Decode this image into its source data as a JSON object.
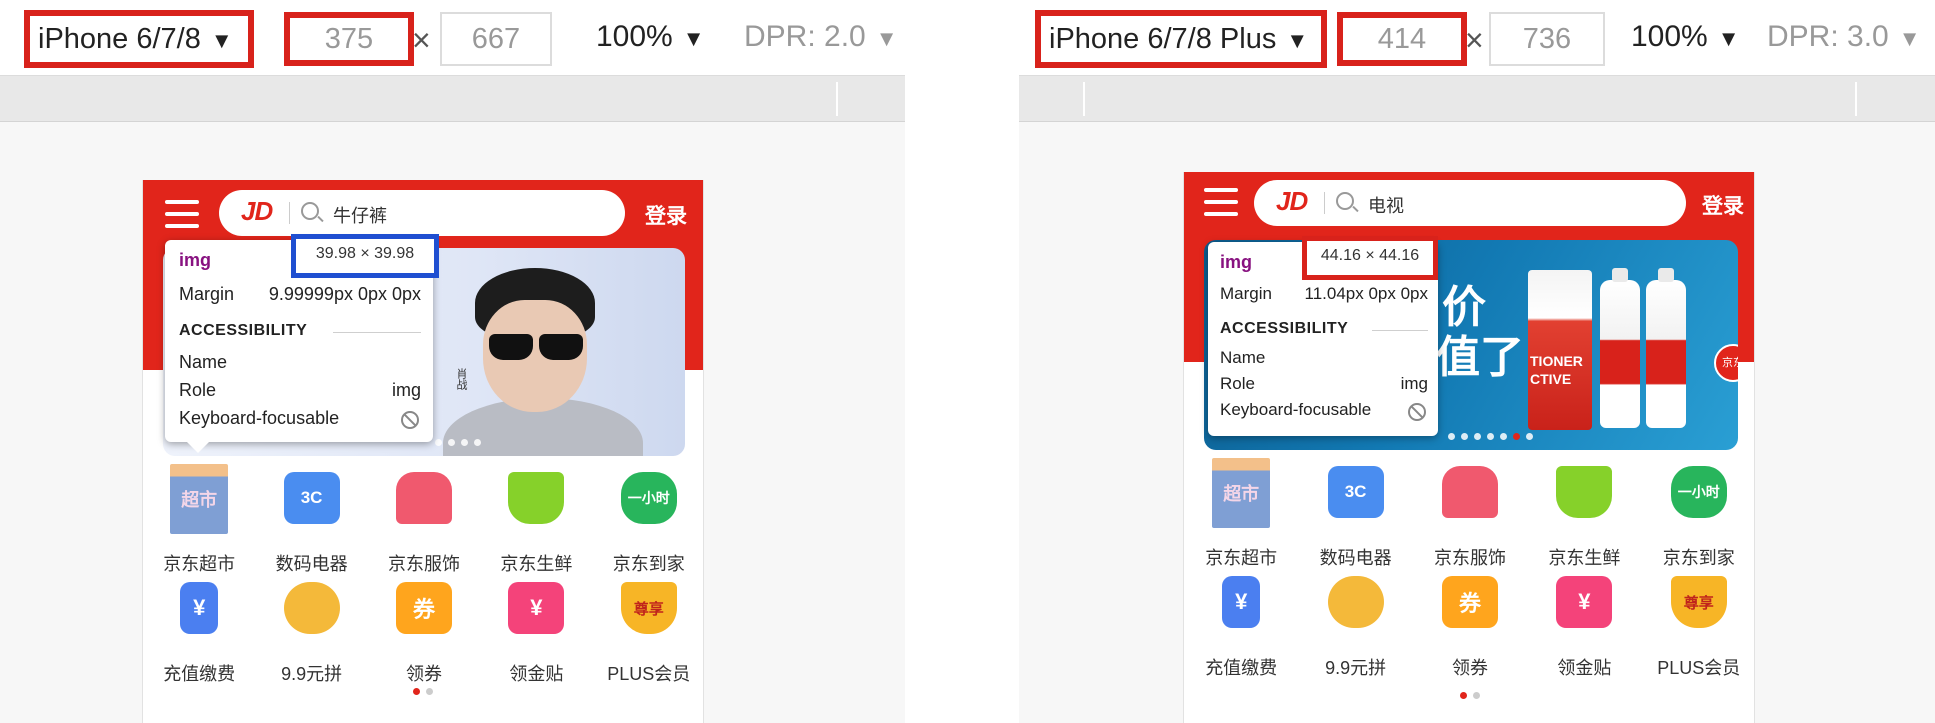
{
  "colors": {
    "highlight_red": "#d8221b",
    "highlight_blue": "#1f4fd1",
    "jd_red": "#e1251b",
    "tag_purple": "#881280"
  },
  "left": {
    "toolbar": {
      "device": "iPhone 6/7/8",
      "width": "375",
      "times": "×",
      "height": "667",
      "zoom": "100%",
      "dpr": "DPR: 2.0",
      "caret": "▼"
    },
    "phone": {
      "search_logo": "JD",
      "search_keyword": "牛仔裤",
      "login": "登录",
      "tooltip": {
        "tag": "img",
        "size": "39.98 × 39.98",
        "margin_label": "Margin",
        "margin_value": "9.99999px 0px 0px",
        "section": "ACCESSIBILITY",
        "name_label": "Name",
        "role_label": "Role",
        "role_value": "img",
        "focus_label": "Keyboard-focusable"
      },
      "banner_vertical_text": "肖战",
      "grid": [
        {
          "label": "京东超市",
          "icon": "supermarket-icon",
          "glyph": "超市"
        },
        {
          "label": "数码电器",
          "icon": "electronics-icon",
          "glyph": "3C"
        },
        {
          "label": "京东服饰",
          "icon": "clothing-icon",
          "glyph": ""
        },
        {
          "label": "京东生鲜",
          "icon": "fresh-basket-icon",
          "glyph": ""
        },
        {
          "label": "京东到家",
          "icon": "delivery-icon",
          "glyph": "一小时"
        },
        {
          "label": "充值缴费",
          "icon": "recharge-icon",
          "glyph": "¥"
        },
        {
          "label": "9.9元拼",
          "icon": "cow-mascot-icon",
          "glyph": ""
        },
        {
          "label": "领券",
          "icon": "coupon-icon",
          "glyph": "券"
        },
        {
          "label": "领金贴",
          "icon": "gold-envelope-icon",
          "glyph": "¥"
        },
        {
          "label": "PLUS会员",
          "icon": "plus-crown-icon",
          "glyph": "尊享"
        }
      ]
    }
  },
  "right": {
    "toolbar": {
      "device": "iPhone 6/7/8 Plus",
      "width": "414",
      "times": "×",
      "height": "736",
      "zoom": "100%",
      "dpr": "DPR: 3.0",
      "caret": "▼"
    },
    "phone": {
      "search_logo": "JD",
      "search_keyword": "电视",
      "login": "登录",
      "tooltip": {
        "tag": "img",
        "size": "44.16 × 44.16",
        "margin_label": "Margin",
        "margin_value": "11.04px 0px 0px",
        "section": "ACCESSIBILITY",
        "name_label": "Name",
        "role_label": "Role",
        "role_value": "img",
        "focus_label": "Keyboard-focusable"
      },
      "banner_text_line1": "价",
      "banner_text_line2": "值了!",
      "banner_box_text": "TIONER CTIVE",
      "banner_badge": "京东",
      "grid": [
        {
          "label": "京东超市",
          "icon": "supermarket-icon",
          "glyph": "超市"
        },
        {
          "label": "数码电器",
          "icon": "electronics-icon",
          "glyph": "3C"
        },
        {
          "label": "京东服饰",
          "icon": "clothing-icon",
          "glyph": ""
        },
        {
          "label": "京东生鲜",
          "icon": "fresh-basket-icon",
          "glyph": ""
        },
        {
          "label": "京东到家",
          "icon": "delivery-icon",
          "glyph": "一小时"
        },
        {
          "label": "充值缴费",
          "icon": "recharge-icon",
          "glyph": "¥"
        },
        {
          "label": "9.9元拼",
          "icon": "cow-mascot-icon",
          "glyph": ""
        },
        {
          "label": "领券",
          "icon": "coupon-icon",
          "glyph": "券"
        },
        {
          "label": "领金贴",
          "icon": "gold-envelope-icon",
          "glyph": "¥"
        },
        {
          "label": "PLUS会员",
          "icon": "plus-crown-icon",
          "glyph": "尊享"
        }
      ]
    }
  }
}
